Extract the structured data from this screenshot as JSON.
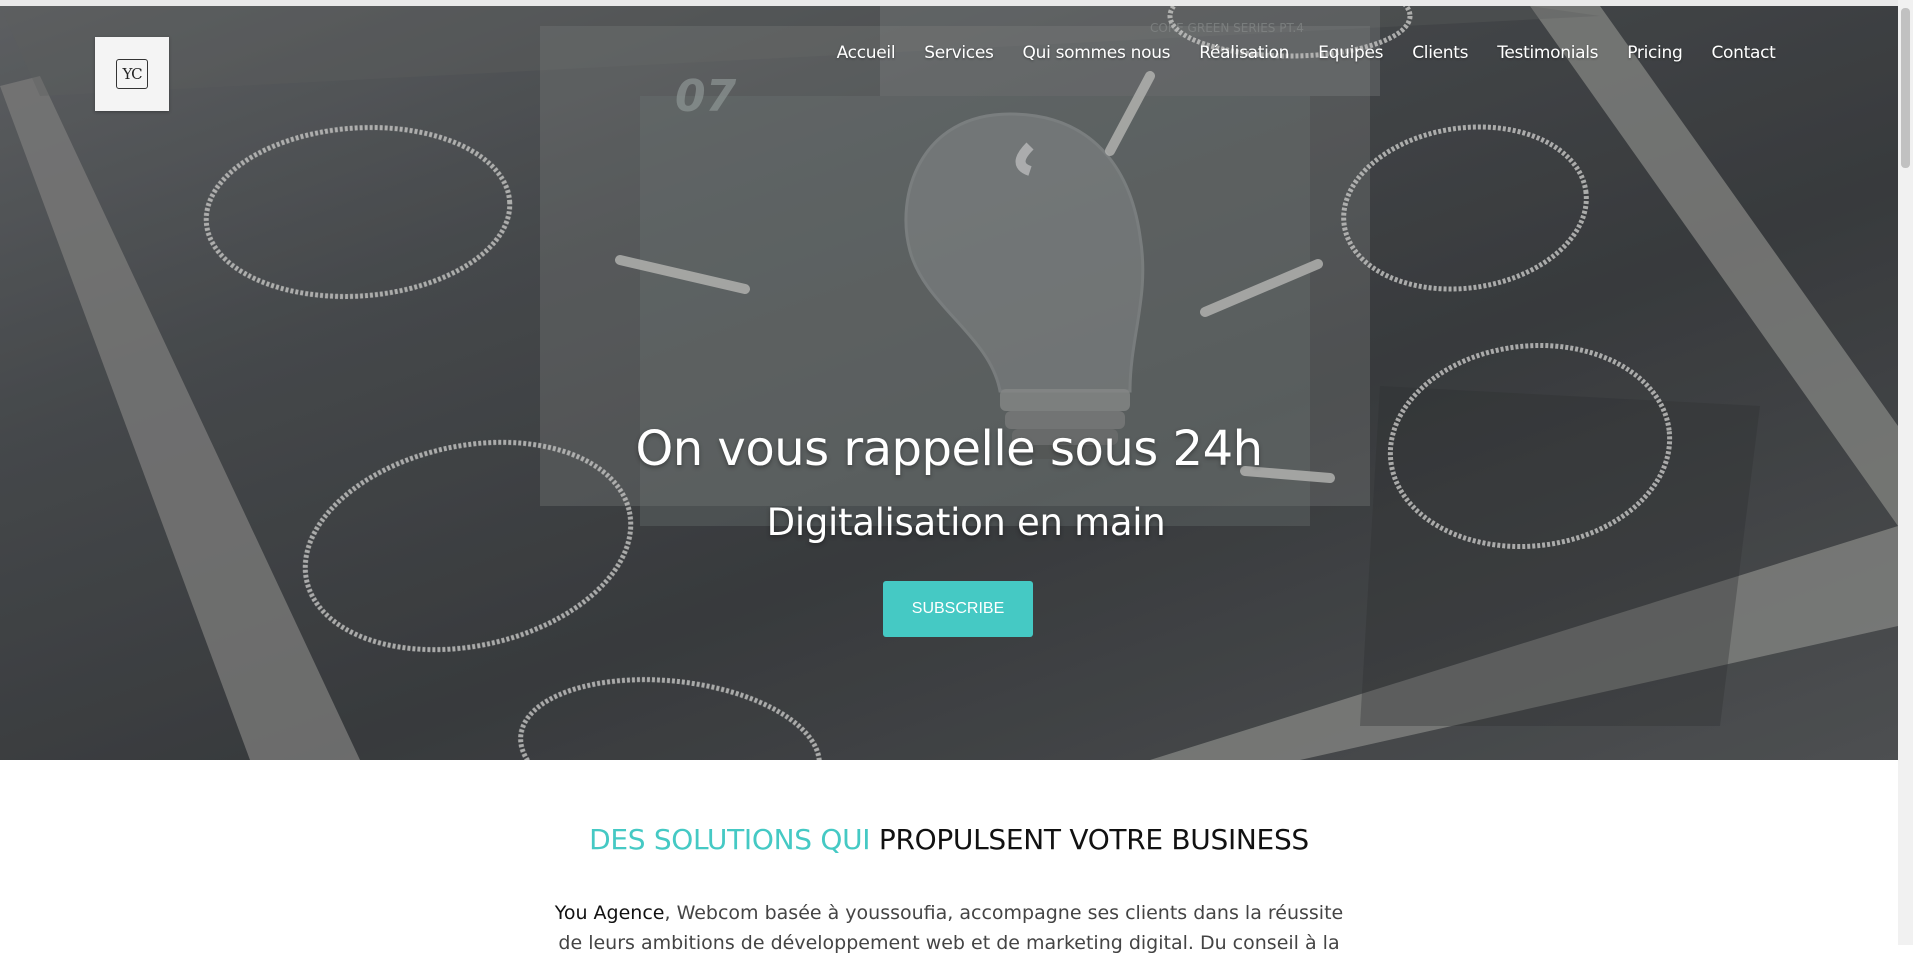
{
  "logo": {
    "text": "YC"
  },
  "nav": {
    "items": [
      "Accueil",
      "Services",
      "Qui sommes nous",
      "Réalisation",
      "Equipes",
      "Clients",
      "Testimonials",
      "Pricing",
      "Contact"
    ]
  },
  "hero": {
    "title": "On vous rappelle sous 24h",
    "subtitle": "Digitalisation en main",
    "cta_label": "SUBSCRIBE",
    "background_marks": [
      "07",
      "CORE GREEN SERIES PT.4"
    ]
  },
  "section": {
    "title_accent": "DES SOLUTIONS QUI",
    "title_rest": "PROPULSENT VOTRE BUSINESS",
    "intro_brand": "You Agence",
    "intro_text": ", Webcom basée à youssoufia, accompagne ses clients dans la réussite de leurs ambitions de développement web et de marketing digital. Du conseil à la"
  },
  "colors": {
    "accent": "#45c9c4",
    "text_dark": "#111111",
    "overlay": "#4a4d4f"
  }
}
